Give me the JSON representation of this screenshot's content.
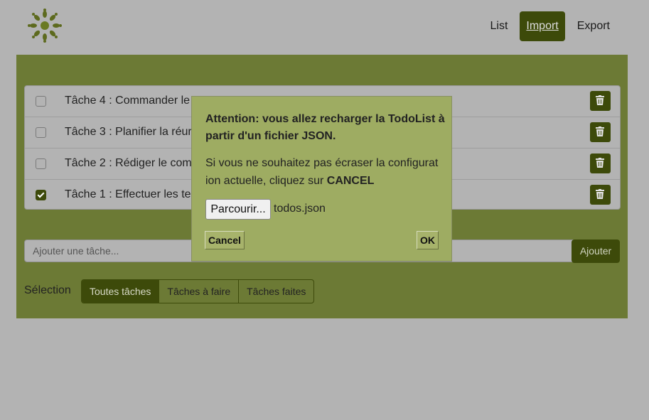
{
  "header": {
    "logo": "sun-logo-icon",
    "nav": [
      {
        "label": "List"
      },
      {
        "label": "Import"
      },
      {
        "label": "Export"
      }
    ]
  },
  "tasks": [
    {
      "label": "Tâche 4 : Commander le",
      "done": false
    },
    {
      "label": "Tâche 3 : Planifier la réur",
      "done": false
    },
    {
      "label": "Tâche 2 : Rédiger le com",
      "done": false
    },
    {
      "label": "Tâche 1 : Effectuer les te",
      "done": true
    }
  ],
  "add": {
    "placeholder": "Ajouter une tâche...",
    "button": "Ajouter"
  },
  "selection": {
    "label": "Sélection",
    "filters": [
      "Toutes tâches",
      "Tâches à faire",
      "Tâches faites"
    ]
  },
  "modal": {
    "title": "Attention: vous allez recharger la TodoList à partir d'un fichier JSON.",
    "text": "Si vous ne souhaitez pas écraser la configuration actuelle, cliquez sur ",
    "text_bold": "CANCEL",
    "browse": "Parcourir...",
    "filename": "todos.json",
    "cancel": "Cancel",
    "ok": "OK"
  },
  "colors": {
    "background": "#b3b3b3",
    "panel": "#6c7a35",
    "accent": "#3d4a0a",
    "modal": "#9eac62"
  }
}
